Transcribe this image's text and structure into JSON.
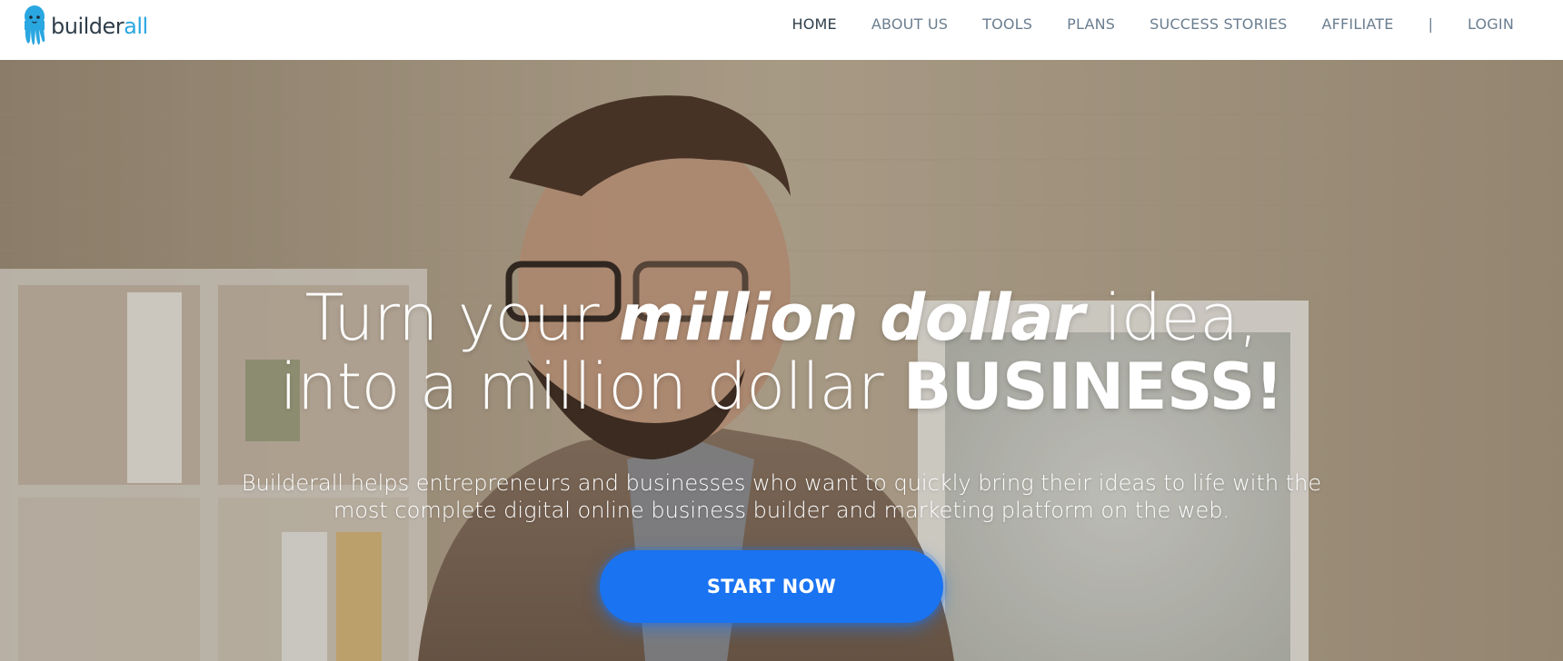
{
  "brand": {
    "name_part1": "builder",
    "name_part2": "all",
    "primary_color": "#2aa7e1",
    "text_color": "#2f3e4a",
    "logo_icon": "octopus-mascot-icon"
  },
  "nav": {
    "items": [
      {
        "label": "HOME",
        "active": true
      },
      {
        "label": "ABOUT US",
        "active": false
      },
      {
        "label": "TOOLS",
        "active": false
      },
      {
        "label": "PLANS",
        "active": false
      },
      {
        "label": "SUCCESS STORIES",
        "active": false
      },
      {
        "label": "AFFILIATE",
        "active": false
      }
    ],
    "separator": "|",
    "login": "LOGIN"
  },
  "hero": {
    "line1_part1": "Turn your ",
    "line1_emphasis": "million dollar",
    "line1_part2": " idea,",
    "line2_part1": "into a million dollar ",
    "line2_strong": "BUSINESS!",
    "subtext": "Builderall helps entrepreneurs and businesses who want to quickly bring their ideas to life with the most complete digital online business builder and marketing platform on the web.",
    "cta_label": "START NOW",
    "cta_color": "#1a73f0"
  }
}
